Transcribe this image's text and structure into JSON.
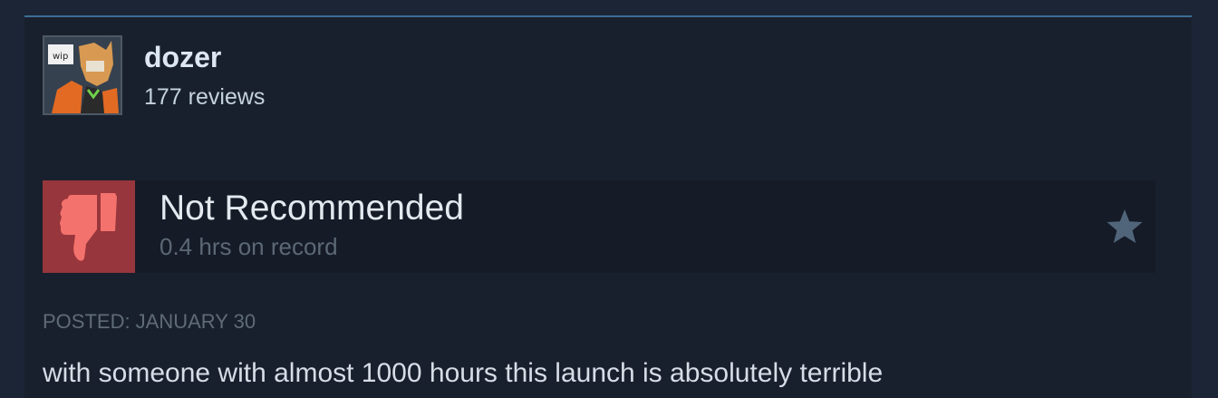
{
  "review": {
    "author_name": "dozer",
    "review_count": "177 reviews",
    "verdict": "Not Recommended",
    "hours": "0.4 hrs on record",
    "posted": "POSTED: JANUARY 30",
    "body": "with someone with almost 1000 hours this launch is absolutely terrible"
  },
  "icons": {
    "avatar": "avatar",
    "thumb": "thumbs-down-icon",
    "star": "star-icon"
  },
  "colors": {
    "not_recommended_bg": "#97363c",
    "thumb": "#f4726d",
    "card_border": "#3c6e95"
  }
}
